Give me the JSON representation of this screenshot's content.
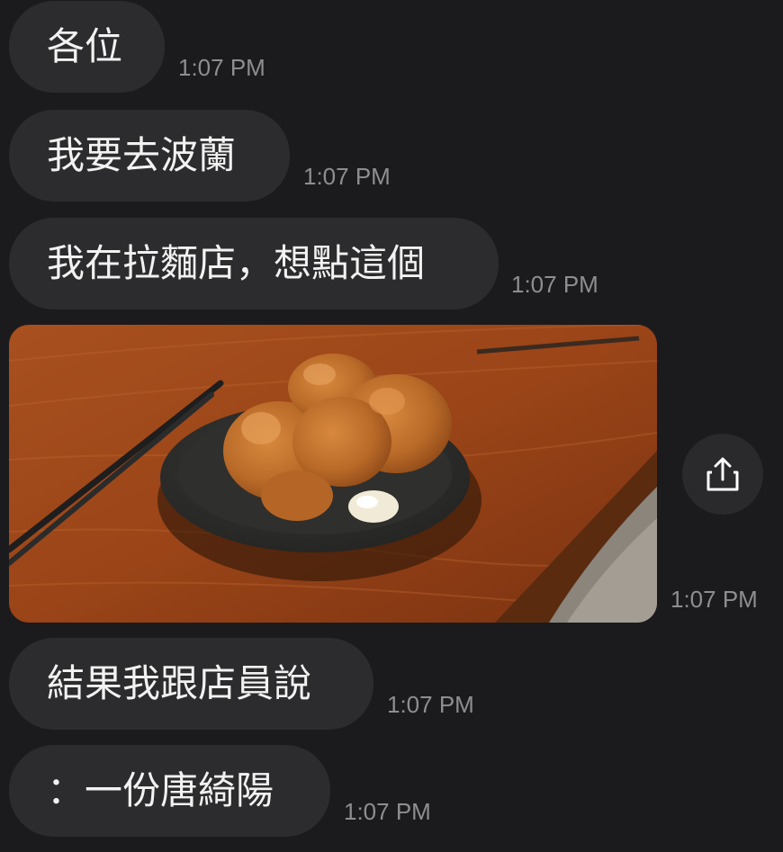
{
  "messages": [
    {
      "text": "各位",
      "time": "1:07 PM"
    },
    {
      "text": "我要去波蘭",
      "time": "1:07 PM"
    },
    {
      "text": "我在拉麵店，想點這個",
      "time": "1:07 PM"
    },
    {
      "photo_time": "1:07 PM"
    },
    {
      "text": "結果我跟店員說",
      "time": "1:07 PM"
    },
    {
      "text": "：一份唐綺陽",
      "time": "1:07 PM"
    }
  ],
  "icons": {
    "share": "share-icon"
  },
  "colors": {
    "background": "#1b1b1d",
    "bubble": "#2c2c2e",
    "text": "#f2f2f2",
    "timestamp": "#8e8e92"
  }
}
